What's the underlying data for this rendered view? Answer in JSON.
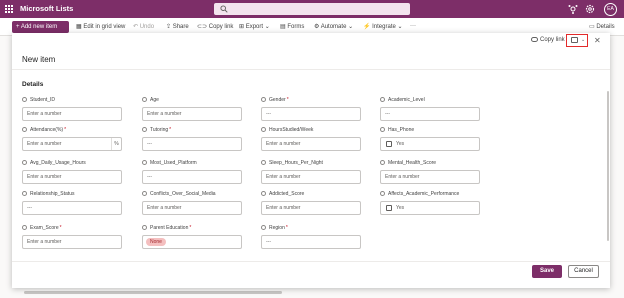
{
  "app": {
    "title": "Microsoft Lists",
    "avatar_initials": "EA"
  },
  "commands": {
    "new_item": "+ Add new item",
    "edit_grid": "Edit in grid view",
    "undo": "Undo",
    "share": "Share",
    "copy_link": "Copy link",
    "export": "Export",
    "forms": "Forms",
    "automate": "Automate",
    "integrate": "Integrate",
    "more": "···",
    "details": "Details"
  },
  "dialog": {
    "copy_link": "Copy link",
    "title": "New item",
    "section": "Details",
    "save": "Save",
    "cancel": "Cancel"
  },
  "fields": [
    {
      "label": "Student_ID",
      "required": false,
      "value": "Enter a number"
    },
    {
      "label": "Age",
      "required": false,
      "value": "Enter a number"
    },
    {
      "label": "Gender",
      "required": true,
      "value": "---"
    },
    {
      "label": "Academic_Level",
      "required": false,
      "value": "---"
    },
    {
      "label": "Attendance(%)",
      "required": true,
      "value": "Enter a number",
      "suffix": "%"
    },
    {
      "label": "Tutoring",
      "required": true,
      "value": "---"
    },
    {
      "label": "HoursStudied/Week",
      "required": false,
      "value": "Enter a number"
    },
    {
      "label": "Has_Phone",
      "required": false,
      "value": "Yes"
    },
    {
      "label": "Avg_Daily_Usage_Hours",
      "required": false,
      "value": "Enter a number"
    },
    {
      "label": "Most_Used_Platform",
      "required": false,
      "value": "---"
    },
    {
      "label": "Sleep_Hours_Per_Night",
      "required": false,
      "value": "Enter a number"
    },
    {
      "label": "Mental_Health_Score",
      "required": false,
      "value": "Enter a number"
    },
    {
      "label": "Relationship_Status",
      "required": false,
      "value": "---"
    },
    {
      "label": "Conflicts_Over_Social_Media",
      "required": false,
      "value": "Enter a number"
    },
    {
      "label": "Addicted_Score",
      "required": false,
      "value": "Enter a number"
    },
    {
      "label": "Affects_Academic_Performance",
      "required": false,
      "value": "Yes"
    },
    {
      "label": "Exam_Score",
      "required": true,
      "value": "Enter a number"
    },
    {
      "label": "Parent Education",
      "required": true,
      "value": "None"
    },
    {
      "label": "Region",
      "required": true,
      "value": "---"
    }
  ],
  "colors": {
    "brand": "#7d2e68",
    "required": "#c50f1f",
    "highlight": "#e32b2b"
  }
}
